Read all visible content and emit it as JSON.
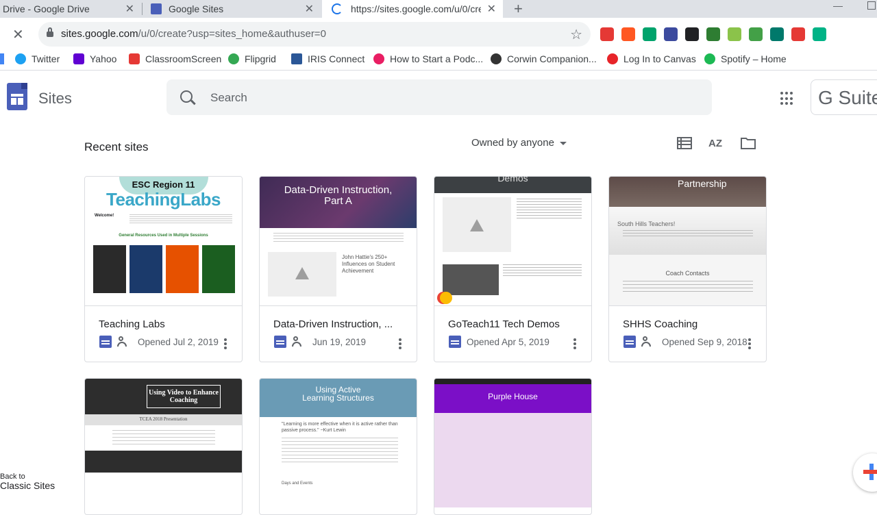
{
  "browser": {
    "tabs": [
      {
        "label": "Drive - Google Drive"
      },
      {
        "label": "Google Sites"
      },
      {
        "label": "https://sites.google.com/u/0/cre"
      }
    ],
    "url_main": "sites.google.com",
    "url_rest": "/u/0/create?usp=sites_home&authuser=0",
    "bookmarks": [
      {
        "label": "Twitter",
        "color": "#1da1f2"
      },
      {
        "label": "Yahoo",
        "color": "#6001d2"
      },
      {
        "label": "ClassroomScreen",
        "color": "#e53935"
      },
      {
        "label": "Flipgrid",
        "color": "#34a853"
      },
      {
        "label": "IRIS Connect",
        "color": "#2b5797"
      },
      {
        "label": "How to Start a Podc...",
        "color": "#e91e63"
      },
      {
        "label": "Corwin Companion...",
        "color": "#333333"
      },
      {
        "label": "Log In to Canvas",
        "color": "#e72429"
      },
      {
        "label": "Spotify – Home",
        "color": "#1db954"
      }
    ],
    "extension_colors": [
      "#e53935",
      "#ff5722",
      "#00a36c",
      "#3c4a9e",
      "#202124",
      "#2e7d32",
      "#8bc34a",
      "#43a047",
      "#00796b",
      "#e53935",
      "#00b386"
    ]
  },
  "app": {
    "title": "Sites",
    "search_placeholder": "Search",
    "gsuite_label": "G Suite"
  },
  "toolbar": {
    "section_title": "Recent sites",
    "owner_filter": "Owned by anyone"
  },
  "sites": [
    {
      "title": "Teaching Labs",
      "opened": "Opened Jul 2, 2019",
      "thumb_heading": "ESC Region 11",
      "thumb_subheading": "TeachingLabs",
      "thumb_section": "General Resources Used in Multiple Sessions",
      "thumb_welcome": "Welcome!"
    },
    {
      "title": "Data-Driven Instruction, ...",
      "opened": "Jun 19, 2019",
      "thumb_heading": "Data-Driven Instruction, Part A",
      "thumb_note": "John Hattie's 250+ Influences on Student Achievement"
    },
    {
      "title": "GoTeach11 Tech Demos",
      "opened": "Opened Apr 5, 2019",
      "thumb_heading": "Demos"
    },
    {
      "title": "SHHS Coaching",
      "opened": "Opened Sep 9, 2018",
      "thumb_heading": "Partnership",
      "thumb_sub": "South Hills Teachers!",
      "thumb_contact": "Coach Contacts"
    },
    {
      "title": "",
      "opened": "",
      "thumb_heading": "Using Video to Enhance Coaching",
      "thumb_sub": "TCEA 2018 Presentation"
    },
    {
      "title": "",
      "opened": "",
      "thumb_heading": "Using Active Learning Structures",
      "thumb_quote": "\"Learning is more effective when it is active rather than passive process.\" ~Kurt Lewin",
      "thumb_section": "Days and Events"
    },
    {
      "title": "",
      "opened": "",
      "thumb_heading": "Purple House"
    }
  ],
  "footer": {
    "back_label": "Back to",
    "classic_label": "Classic Sites"
  }
}
